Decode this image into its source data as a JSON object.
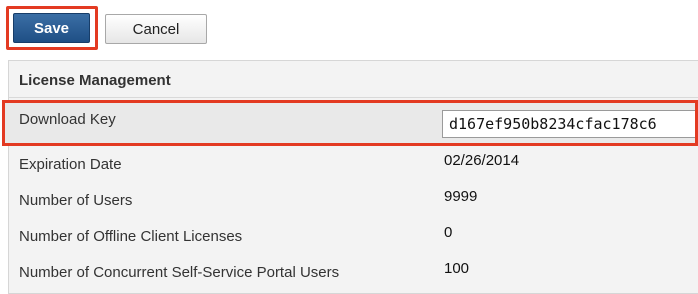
{
  "toolbar": {
    "save_label": "Save",
    "cancel_label": "Cancel"
  },
  "panel": {
    "title": "License Management",
    "download_key": {
      "label": "Download Key",
      "value": "d167ef950b8234cfac178c6"
    },
    "rows": [
      {
        "label": "Expiration Date",
        "value": "02/26/2014"
      },
      {
        "label": "Number of Users",
        "value": "9999"
      },
      {
        "label": "Number of Offline Client Licenses",
        "value": "0"
      },
      {
        "label": "Number of Concurrent Self-Service Portal Users",
        "value": "100"
      }
    ]
  },
  "colors": {
    "highlight": "#e33a22",
    "save_button": "#2a5b92",
    "panel_bg": "#f3f3f3"
  }
}
